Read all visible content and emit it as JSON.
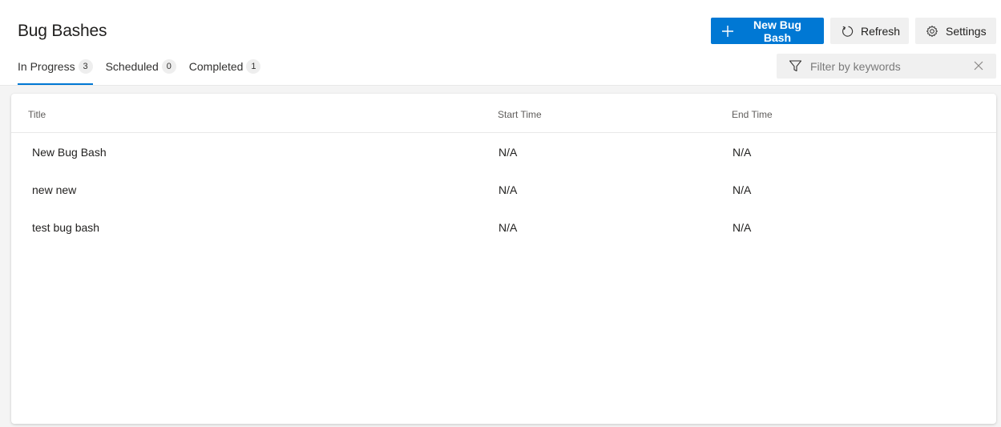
{
  "page": {
    "title": "Bug Bashes"
  },
  "tabs": [
    {
      "label": "In Progress",
      "count": "3"
    },
    {
      "label": "Scheduled",
      "count": "0"
    },
    {
      "label": "Completed",
      "count": "1"
    }
  ],
  "toolbar": {
    "new_label": "New Bug Bash",
    "refresh_label": "Refresh",
    "settings_label": "Settings"
  },
  "filter": {
    "placeholder": "Filter by keywords",
    "value": ""
  },
  "table": {
    "columns": [
      "Title",
      "Start Time",
      "End Time"
    ],
    "rows": [
      [
        "New Bug Bash",
        "N/A",
        "N/A"
      ],
      [
        "new new",
        "N/A",
        "N/A"
      ],
      [
        "test bug bash",
        "N/A",
        "N/A"
      ]
    ]
  },
  "colors": {
    "accent": "#0078d4",
    "background": "#f4f4f4"
  },
  "icons": [
    "add-icon",
    "refresh-icon",
    "gear-icon",
    "filter-icon",
    "close-icon"
  ]
}
